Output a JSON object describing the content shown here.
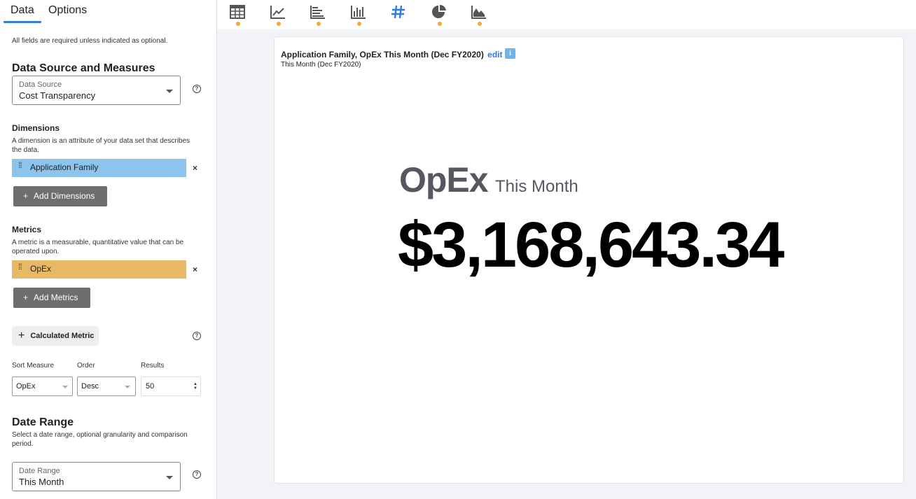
{
  "tabs": {
    "data": "Data",
    "options": "Options"
  },
  "note": "All fields are required unless indicated as optional.",
  "data_source_section": {
    "heading": "Data Source and Measures",
    "label": "Data Source",
    "value": "Cost Transparency"
  },
  "dimensions": {
    "heading": "Dimensions",
    "description": "A dimension is an attribute of your data set that describes the data.",
    "items": [
      {
        "label": "Application Family",
        "color": "#8cc4ee"
      }
    ],
    "add_label": "Add Dimensions"
  },
  "metrics": {
    "heading": "Metrics",
    "description": "A metric is a measurable, quantitative value that can be operated upon.",
    "items": [
      {
        "label": "OpEx",
        "color": "#e8b964"
      }
    ],
    "add_label": "Add Metrics"
  },
  "calculated_metric_label": "Calculated Metric",
  "sort": {
    "sort_measure_label": "Sort Measure",
    "sort_measure_value": "OpEx",
    "order_label": "Order",
    "order_value": "Desc",
    "results_label": "Results",
    "results_value": "50"
  },
  "date_range": {
    "heading": "Date Range",
    "description": "Select a date range, optional granularity and comparison period.",
    "label": "Date Range",
    "value": "This Month"
  },
  "toolbar": {
    "items": [
      "table-icon",
      "line-chart-icon",
      "horizontal-bar-icon",
      "vertical-bar-icon",
      "number-icon",
      "pie-chart-icon",
      "area-chart-icon"
    ],
    "active": "number-icon",
    "accent": "#2f7ae0",
    "dot_color": "#f2a93b"
  },
  "card": {
    "title": "Application Family, OpEx This Month (Dec FY2020)",
    "edit_label": "edit",
    "info_label": "i",
    "subtitle": "This Month (Dec FY2020)",
    "kpi_metric": "OpEx",
    "kpi_period": "This Month",
    "kpi_value": "$3,168,643.34"
  }
}
